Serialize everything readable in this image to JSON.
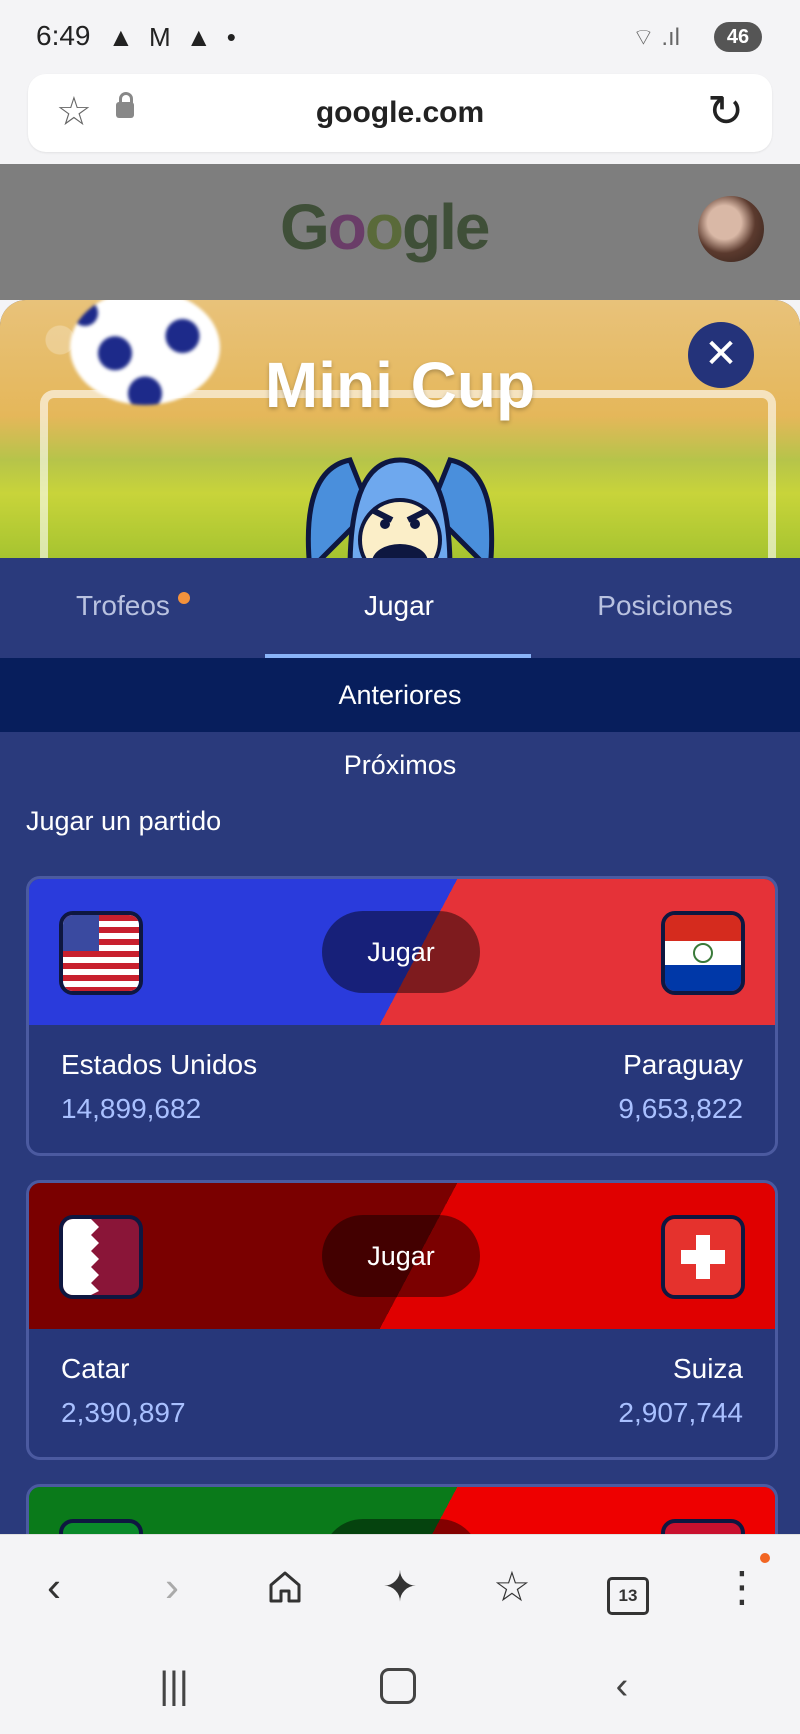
{
  "status": {
    "time": "6:49",
    "left_icons": "▲ M ▲ •",
    "right_icons": "⌔ .ıl",
    "battery": "46"
  },
  "address": {
    "url": "google.com",
    "star_icon": "star-outline-icon",
    "lock_icon": "lock-icon",
    "reload_icon": "reload-icon"
  },
  "google": {
    "doodle_letters": [
      "G",
      "o",
      "o",
      "gle"
    ]
  },
  "game": {
    "title": "Mini Cup",
    "close_glyph": "✕",
    "tabs": [
      {
        "label": "Trofeos",
        "notification": true
      },
      {
        "label": "Jugar",
        "active": true
      },
      {
        "label": "Posiciones"
      }
    ],
    "anteriores_label": "Anteriores",
    "proximos_label": "Próximos",
    "section_heading": "Jugar un partido",
    "play_label": "Jugar",
    "matches": [
      {
        "left_team": "Estados Unidos",
        "left_count": "14,899,682",
        "right_team": "Paraguay",
        "right_count": "9,653,822"
      },
      {
        "left_team": "Catar",
        "left_count": "2,390,897",
        "right_team": "Suiza",
        "right_count": "2,907,744"
      }
    ]
  },
  "colors": {
    "sheet_bg": "#2a3a7c",
    "active_tab_indicator": "#8ab4f8",
    "anteriores_bg": "#071e5c",
    "count_text": "#a9c0ff",
    "notification_dot": "#f4923c"
  },
  "browser_nav": {
    "back": "‹",
    "forward": "›",
    "tabs_count": "13"
  }
}
